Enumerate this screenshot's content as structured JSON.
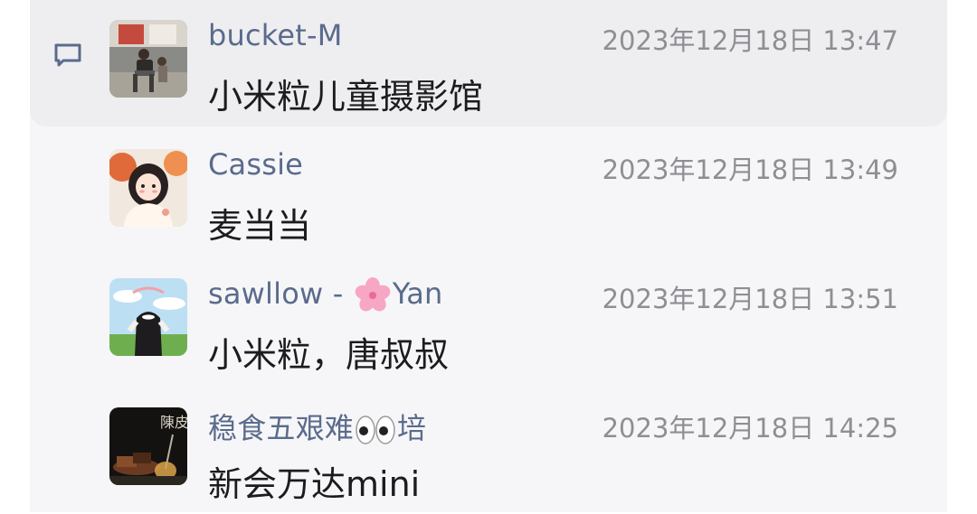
{
  "comments": [
    {
      "name": "bucket-M",
      "time": "2023年12月18日 13:47",
      "message": "小米粒儿童摄影馆",
      "avatar_icon": "person-photo-avatar"
    },
    {
      "name": "Cassie",
      "time": "2023年12月18日 13:49",
      "message": "麦当当",
      "avatar_icon": "cartoon-girl-avatar"
    },
    {
      "name_prefix": "sawllow - ",
      "name_suffix": "Yan",
      "name_emoji": "cherry-blossom-emoji",
      "time": "2023年12月18日 13:51",
      "message": "小米粒，唐叔叔",
      "avatar_icon": "girl-back-view-avatar"
    },
    {
      "name_prefix": "稳食五艰难",
      "name_suffix": "培",
      "name_emoji": "eyes-emoji",
      "time": "2023年12月18日 14:25",
      "message": "新会万达mini",
      "avatar_icon": "dessert-photo-avatar",
      "avatar_text": "陳皮"
    }
  ],
  "colors": {
    "name": "#5a6b8c",
    "time": "#8e8e93",
    "message": "#1c1c1e",
    "panel": "#f6f6f8",
    "highlight": "#eeeef1"
  }
}
